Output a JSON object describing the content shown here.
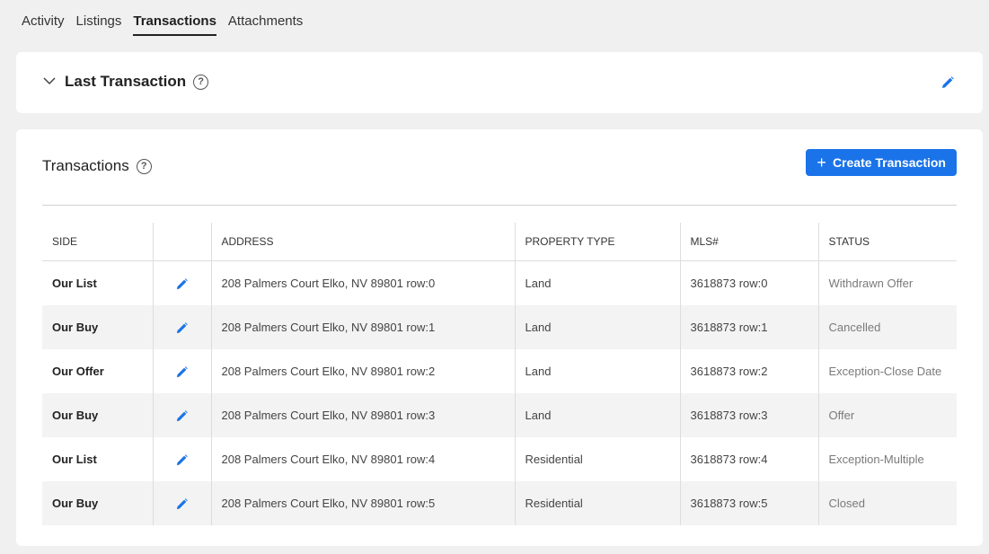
{
  "tabs": [
    {
      "label": "Activity"
    },
    {
      "label": "Listings"
    },
    {
      "label": "Transactions"
    },
    {
      "label": "Attachments"
    }
  ],
  "last_transaction": {
    "title": "Last Transaction"
  },
  "transactions": {
    "title": "Transactions",
    "create_label": "Create Transaction",
    "columns": {
      "side": "SIDE",
      "address": "ADDRESS",
      "property_type": "PROPERTY TYPE",
      "mls": "MLS#",
      "status": "STATUS"
    },
    "rows": [
      {
        "side": "Our List",
        "address": "208 Palmers Court Elko, NV 89801 row:0",
        "property_type": "Land",
        "mls": "3618873 row:0",
        "status": "Withdrawn Offer"
      },
      {
        "side": "Our Buy",
        "address": "208 Palmers Court Elko, NV 89801 row:1",
        "property_type": "Land",
        "mls": "3618873 row:1",
        "status": "Cancelled"
      },
      {
        "side": "Our Offer",
        "address": "208 Palmers Court Elko, NV 89801 row:2",
        "property_type": "Land",
        "mls": "3618873 row:2",
        "status": "Exception-Close Date"
      },
      {
        "side": "Our Buy",
        "address": "208 Palmers Court Elko, NV 89801 row:3",
        "property_type": "Land",
        "mls": "3618873 row:3",
        "status": "Offer"
      },
      {
        "side": "Our List",
        "address": "208 Palmers Court Elko, NV 89801 row:4",
        "property_type": "Residential",
        "mls": "3618873 row:4",
        "status": "Exception-Multiple"
      },
      {
        "side": "Our Buy",
        "address": "208 Palmers Court Elko, NV 89801 row:5",
        "property_type": "Residential",
        "mls": "3618873 row:5",
        "status": "Closed"
      }
    ]
  },
  "colors": {
    "accent": "#1a73e8",
    "background": "#f0f0f0",
    "row_alt": "#f3f3f3"
  },
  "icons": {
    "help": "help-circle-icon",
    "edit": "pencil-icon",
    "collapse": "chevron-down-icon",
    "add": "plus-icon"
  }
}
